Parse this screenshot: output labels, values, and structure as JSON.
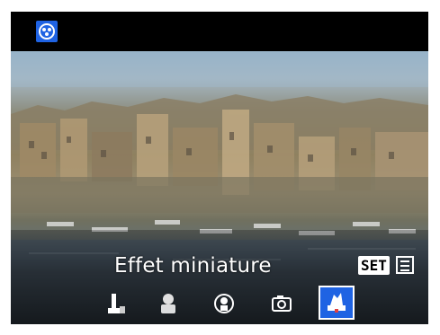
{
  "screen": {
    "mode_icon": "creative-filter-mode-icon",
    "effect_name": "Effet miniature",
    "set_label": "SET",
    "settings_icon": "adjust-settings-icon",
    "effects": [
      {
        "icon": "grainy-bw-icon",
        "selected": false
      },
      {
        "icon": "soft-focus-icon",
        "selected": false
      },
      {
        "icon": "fisheye-icon",
        "selected": false
      },
      {
        "icon": "toy-camera-icon",
        "selected": false
      },
      {
        "icon": "miniature-effect-icon",
        "selected": true
      }
    ]
  }
}
